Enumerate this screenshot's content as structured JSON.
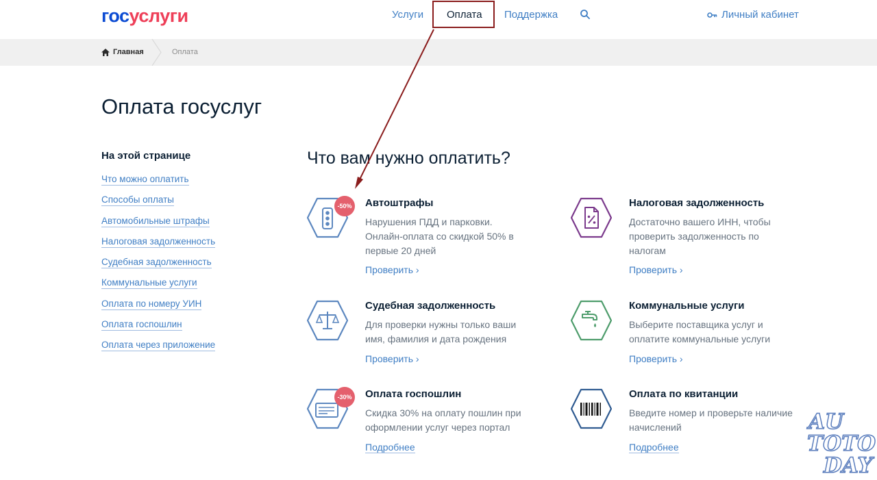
{
  "header": {
    "logo_part1": "гос",
    "logo_part2": "услуги",
    "nav": {
      "services": "Услуги",
      "payment": "Оплата",
      "support": "Поддержка"
    },
    "cabinet": "Личный кабинет"
  },
  "breadcrumb": {
    "home": "Главная",
    "current": "Оплата"
  },
  "page_title": "Оплата госуслуг",
  "toc": {
    "title": "На этой странице",
    "items": [
      "Что можно оплатить",
      "Способы оплаты",
      "Автомобильные штрафы",
      "Налоговая задолженность",
      "Судебная задолженность",
      "Коммунальные услуги",
      "Оплата по номеру УИН",
      "Оплата госпошлин",
      "Оплата через приложение"
    ]
  },
  "section_title": "Что вам нужно оплатить?",
  "cards": [
    {
      "title": "Автоштрафы",
      "badge": "-50%",
      "desc": "Нарушения ПДД и парковки. Онлайн-оплата со скидкой 50% в первые 20 дней",
      "link": "Проверить ›"
    },
    {
      "title": "Налоговая задолженность",
      "desc": "Достаточно вашего ИНН, чтобы проверить задолженность по налогам",
      "link": "Проверить ›"
    },
    {
      "title": "Судебная задолженность",
      "desc": "Для проверки нужны только ваши имя, фамилия и дата рождения",
      "link": "Проверить ›"
    },
    {
      "title": "Коммунальные услуги",
      "desc": "Выберите поставщика услуг и оплатите коммунальные услуги",
      "link": "Проверить ›"
    },
    {
      "title": "Оплата госпошлин",
      "badge": "-30%",
      "desc": "Скидка 30% на оплату пошлин при оформлении услуг через портал",
      "link": "Подробнее"
    },
    {
      "title": "Оплата по квитанции",
      "desc": "Введите номер и проверьте наличие начислений",
      "link": "Подробнее"
    }
  ],
  "watermark": {
    "line1": "AU",
    "line2a": "TO",
    "line2b": "TO",
    "line3": "DAY"
  },
  "colors": {
    "blue": "#3f7ec4",
    "red_badge": "#e4606d",
    "arrow": "#8a1c1c",
    "purple": "#7b3a8c",
    "green": "#4d9c6b",
    "dark_blue": "#2f5b91"
  }
}
